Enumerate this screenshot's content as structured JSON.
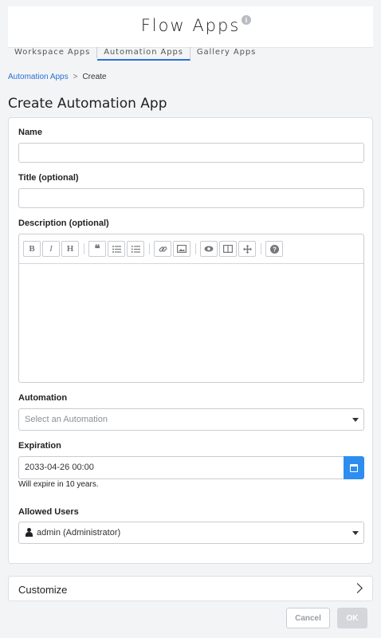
{
  "header": {
    "title": "Flow Apps",
    "info_icon": "info-icon"
  },
  "tabs": [
    {
      "label": "Workspace Apps",
      "active": false
    },
    {
      "label": "Automation Apps",
      "active": true
    },
    {
      "label": "Gallery Apps",
      "active": false
    }
  ],
  "breadcrumb": {
    "parent": "Automation Apps",
    "separator": ">",
    "current": "Create"
  },
  "page_title": "Create Automation App",
  "form": {
    "name": {
      "label": "Name",
      "value": ""
    },
    "title": {
      "label": "Title (optional)",
      "value": ""
    },
    "description": {
      "label": "Description (optional)",
      "toolbar": [
        "bold-icon",
        "italic-icon",
        "heading-icon",
        "quote-icon",
        "unordered-list-icon",
        "ordered-list-icon",
        "link-icon",
        "image-icon",
        "preview-icon",
        "side-by-side-icon",
        "fullscreen-icon",
        "help-icon"
      ],
      "value": ""
    },
    "automation": {
      "label": "Automation",
      "placeholder": "Select an Automation"
    },
    "expiration": {
      "label": "Expiration",
      "value": "2033-04-26 00:00",
      "hint": "Will expire in 10 years."
    },
    "allowed_users": {
      "label": "Allowed Users",
      "value": "admin (Administrator)"
    }
  },
  "customize": {
    "label": "Customize"
  },
  "actions": {
    "cancel": "Cancel",
    "ok": "OK"
  },
  "colors": {
    "accent": "#2a6fd6",
    "date_button": "#2d8ef0"
  }
}
